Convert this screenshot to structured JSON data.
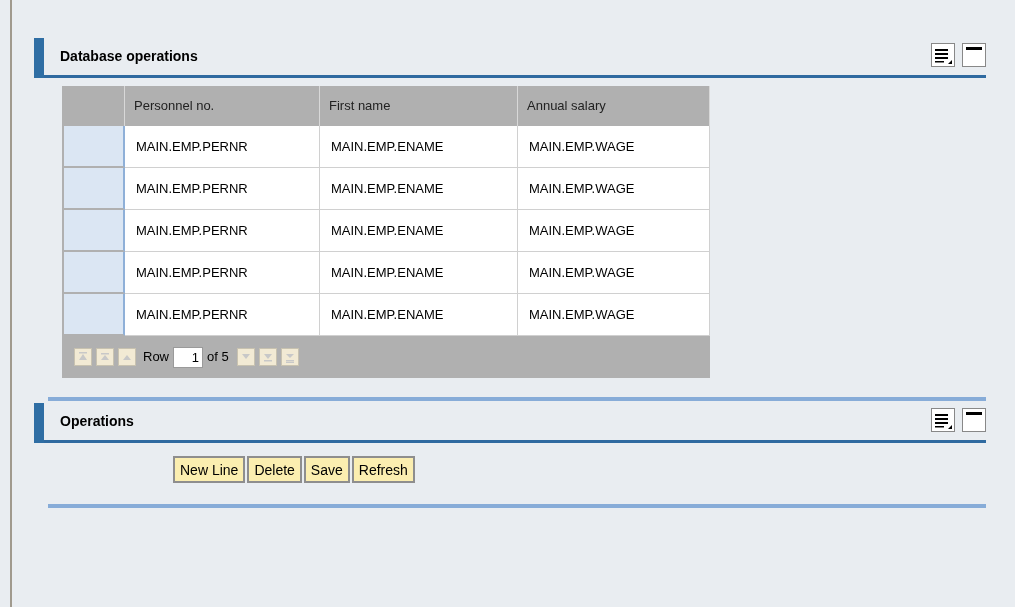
{
  "sections": [
    {
      "title": "Database operations",
      "table": {
        "columns": [
          "Personnel no.",
          "First name",
          "Annual salary"
        ],
        "rows": [
          [
            "MAIN.EMP.PERNR",
            "MAIN.EMP.ENAME",
            "MAIN.EMP.WAGE"
          ],
          [
            "MAIN.EMP.PERNR",
            "MAIN.EMP.ENAME",
            "MAIN.EMP.WAGE"
          ],
          [
            "MAIN.EMP.PERNR",
            "MAIN.EMP.ENAME",
            "MAIN.EMP.WAGE"
          ],
          [
            "MAIN.EMP.PERNR",
            "MAIN.EMP.ENAME",
            "MAIN.EMP.WAGE"
          ],
          [
            "MAIN.EMP.PERNR",
            "MAIN.EMP.ENAME",
            "MAIN.EMP.WAGE"
          ]
        ],
        "pager": {
          "label": "Row",
          "value": "1",
          "total": "of 5"
        }
      }
    },
    {
      "title": "Operations",
      "buttons": [
        "New Line",
        "Delete",
        "Save",
        "Refresh"
      ]
    }
  ]
}
